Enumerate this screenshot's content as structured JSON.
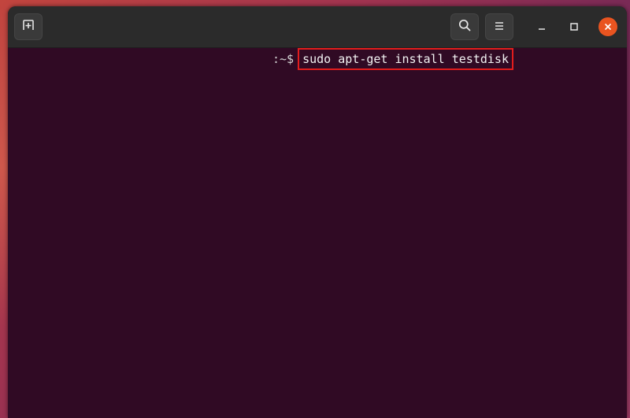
{
  "terminal": {
    "prompt": ":~$",
    "command": "sudo apt-get install testdisk"
  },
  "icons": {
    "new_tab": "new-tab-icon",
    "search": "search-icon",
    "menu": "hamburger-menu-icon",
    "minimize": "minimize-icon",
    "maximize": "maximize-icon",
    "close": "close-icon"
  },
  "colors": {
    "terminal_background": "#300a24",
    "titlebar_background": "#2b2b2b",
    "close_button": "#e95420",
    "highlight_box": "#e21d1d"
  }
}
